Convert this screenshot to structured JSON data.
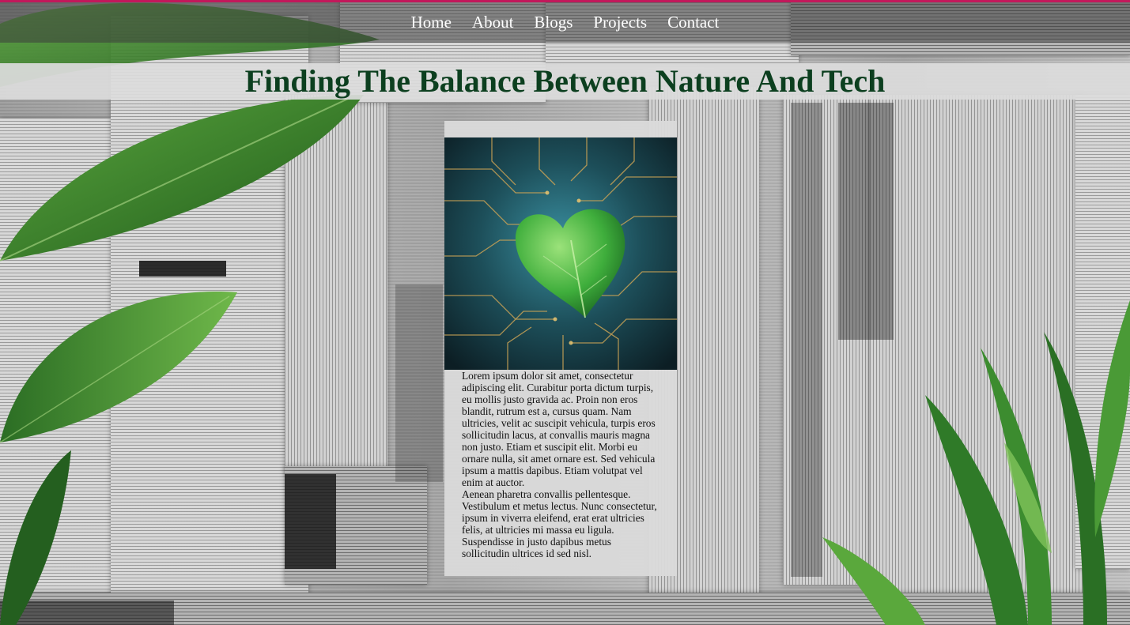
{
  "nav": {
    "items": [
      {
        "label": "Home"
      },
      {
        "label": "About"
      },
      {
        "label": "Blogs"
      },
      {
        "label": "Projects"
      },
      {
        "label": "Contact"
      }
    ]
  },
  "page": {
    "title": "Finding The Balance Between Nature And Tech"
  },
  "article": {
    "paragraphs": [
      "Lorem ipsum dolor sit amet, consectetur adipiscing elit. Curabitur porta dictum turpis, eu mollis justo gravida ac. Proin non eros blandit, rutrum est a, cursus quam. Nam ultricies, velit ac suscipit vehicula, turpis eros sollicitudin lacus, at convallis mauris magna non justo. Etiam et suscipit elit. Morbi eu ornare nulla, sit amet ornare est. Sed vehicula ipsum a mattis dapibus. Etiam volutpat vel enim at auctor.",
      "Aenean pharetra convallis pellentesque. Vestibulum et metus lectus. Nunc consectetur, ipsum in viverra eleifend, erat erat ultricies felis, at ultricies mi massa eu ligula. Suspendisse in justo dapibus metus sollicitudin ultrices id sed nisl."
    ]
  },
  "colors": {
    "title": "#0c3f1f",
    "accent_line": "#c2185b",
    "nav_text": "#ffffff"
  },
  "images": {
    "background": "newspaper-collage-with-leaves",
    "hero": "green-heart-leaf-on-circuit-board"
  }
}
